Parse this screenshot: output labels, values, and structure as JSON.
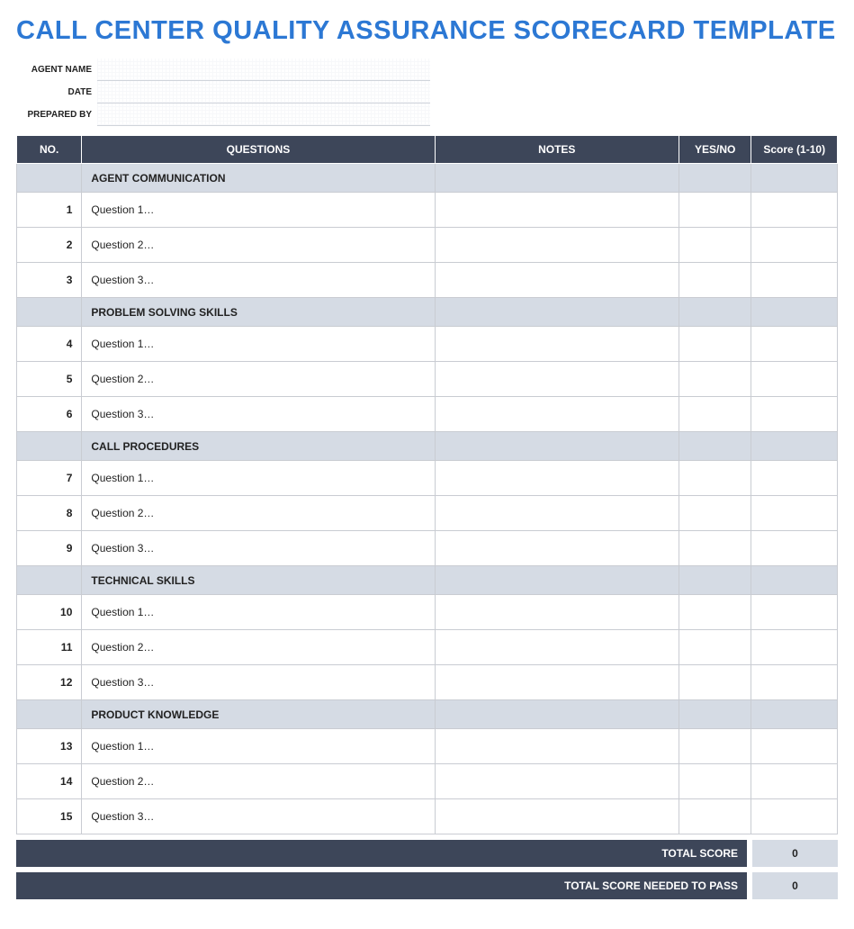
{
  "title": "CALL CENTER QUALITY ASSURANCE SCORECARD TEMPLATE",
  "meta": {
    "agent_name_label": "AGENT NAME",
    "agent_name_value": "",
    "date_label": "DATE",
    "date_value": "",
    "prepared_by_label": "PREPARED BY",
    "prepared_by_value": ""
  },
  "columns": {
    "no": "NO.",
    "questions": "QUESTIONS",
    "notes": "NOTES",
    "yesno": "YES/NO",
    "score": "Score (1-10)"
  },
  "sections": [
    {
      "title": "AGENT COMMUNICATION",
      "rows": [
        {
          "no": "1",
          "question": "Question 1…",
          "notes": "",
          "yesno": "",
          "score": ""
        },
        {
          "no": "2",
          "question": "Question 2…",
          "notes": "",
          "yesno": "",
          "score": ""
        },
        {
          "no": "3",
          "question": "Question 3…",
          "notes": "",
          "yesno": "",
          "score": ""
        }
      ]
    },
    {
      "title": "PROBLEM SOLVING SKILLS",
      "rows": [
        {
          "no": "4",
          "question": "Question 1…",
          "notes": "",
          "yesno": "",
          "score": ""
        },
        {
          "no": "5",
          "question": "Question 2…",
          "notes": "",
          "yesno": "",
          "score": ""
        },
        {
          "no": "6",
          "question": "Question 3…",
          "notes": "",
          "yesno": "",
          "score": ""
        }
      ]
    },
    {
      "title": "CALL PROCEDURES",
      "rows": [
        {
          "no": "7",
          "question": "Question 1…",
          "notes": "",
          "yesno": "",
          "score": ""
        },
        {
          "no": "8",
          "question": "Question 2…",
          "notes": "",
          "yesno": "",
          "score": ""
        },
        {
          "no": "9",
          "question": "Question 3…",
          "notes": "",
          "yesno": "",
          "score": ""
        }
      ]
    },
    {
      "title": "TECHNICAL SKILLS",
      "rows": [
        {
          "no": "10",
          "question": "Question 1…",
          "notes": "",
          "yesno": "",
          "score": ""
        },
        {
          "no": "11",
          "question": "Question 2…",
          "notes": "",
          "yesno": "",
          "score": ""
        },
        {
          "no": "12",
          "question": "Question 3…",
          "notes": "",
          "yesno": "",
          "score": ""
        }
      ]
    },
    {
      "title": "PRODUCT KNOWLEDGE",
      "rows": [
        {
          "no": "13",
          "question": "Question 1…",
          "notes": "",
          "yesno": "",
          "score": ""
        },
        {
          "no": "14",
          "question": "Question 2…",
          "notes": "",
          "yesno": "",
          "score": ""
        },
        {
          "no": "15",
          "question": "Question 3…",
          "notes": "",
          "yesno": "",
          "score": ""
        }
      ]
    }
  ],
  "footer": {
    "total_score_label": "TOTAL SCORE",
    "total_score_value": "0",
    "pass_label": "TOTAL SCORE NEEDED TO PASS",
    "pass_value": "0"
  }
}
